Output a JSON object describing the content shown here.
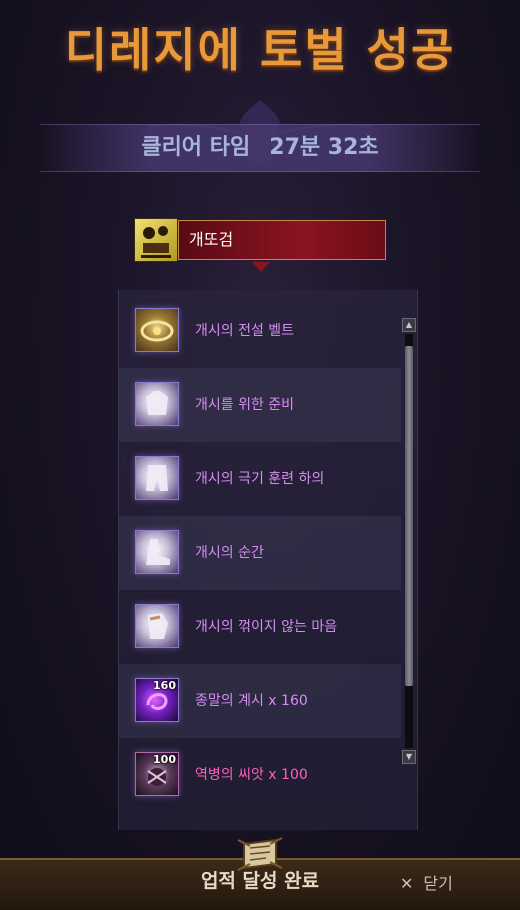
{
  "title": "디레지에 토벌 성공",
  "clear": {
    "label": "클리어 타임",
    "time": "27분 32초"
  },
  "player": {
    "name": "개또검",
    "icon": "player-portrait-icon"
  },
  "rewards": [
    {
      "label": "개시의 전설 벨트",
      "icon": "belt-icon",
      "qty": ""
    },
    {
      "label": "개시를 위한 준비",
      "icon": "armor-icon",
      "qty": ""
    },
    {
      "label": "개시의 극기 훈련 하의",
      "icon": "pants-icon",
      "qty": ""
    },
    {
      "label": "개시의 순간",
      "icon": "shoes-icon",
      "qty": ""
    },
    {
      "label": "개시의 꺾이지 않는 마음",
      "icon": "glove-icon",
      "qty": ""
    },
    {
      "label": "종말의 계시 x 160",
      "icon": "orb-icon",
      "qty": "160"
    },
    {
      "label": "역병의 씨앗 x 100",
      "icon": "seed-icon",
      "qty": "100"
    }
  ],
  "footer": {
    "achievement_label": "업적 달성 완료",
    "close_label": "닫기",
    "close_icon": "close-icon"
  },
  "colors": {
    "title": "#e89a3a",
    "item_purple": "#d68df2",
    "item_pink": "#ff5fbf",
    "name_bar": "#8a1420"
  }
}
